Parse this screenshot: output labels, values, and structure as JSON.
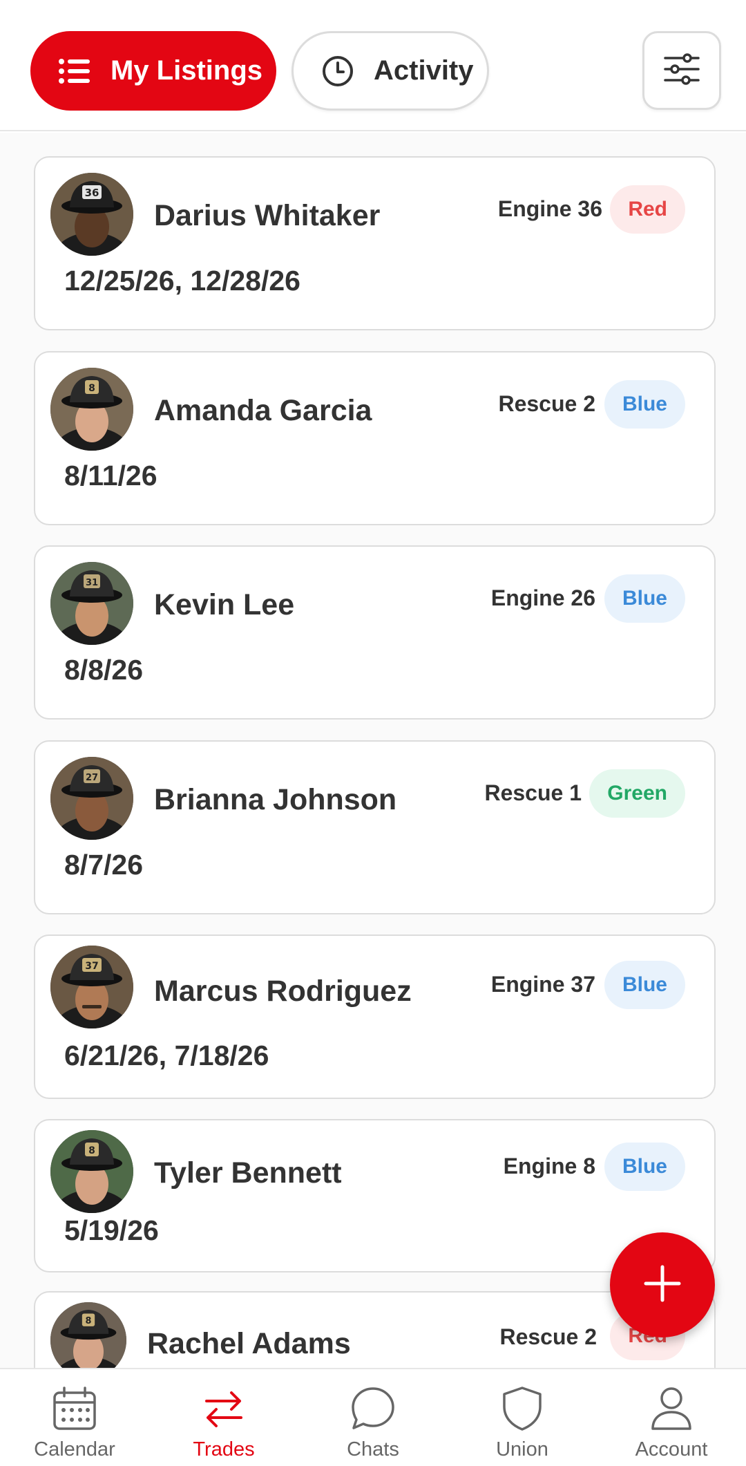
{
  "header": {
    "tabs": [
      {
        "label": "My Listings",
        "icon": "list-icon",
        "active": true
      },
      {
        "label": "Activity",
        "icon": "clock-icon",
        "active": false
      }
    ],
    "filter_icon": "sliders-icon"
  },
  "listings": [
    {
      "name": "Darius Whitaker",
      "unit": "Engine 36",
      "shift": "Red",
      "dates": "12/25/26, 12/28/26",
      "helmet": "36"
    },
    {
      "name": "Amanda Garcia",
      "unit": "Rescue 2",
      "shift": "Blue",
      "dates": "8/11/26",
      "helmet": "8"
    },
    {
      "name": "Kevin Lee",
      "unit": "Engine 26",
      "shift": "Blue",
      "dates": "8/8/26",
      "helmet": "31"
    },
    {
      "name": "Brianna Johnson",
      "unit": "Rescue 1",
      "shift": "Green",
      "dates": "8/7/26",
      "helmet": "27"
    },
    {
      "name": "Marcus Rodriguez",
      "unit": "Engine 37",
      "shift": "Blue",
      "dates": "6/21/26, 7/18/26",
      "helmet": "37"
    },
    {
      "name": "Tyler Bennett",
      "unit": "Engine 8",
      "shift": "Blue",
      "dates": "5/19/26",
      "helmet": "8"
    },
    {
      "name": "Rachel Adams",
      "unit": "Rescue 2",
      "shift": "Red",
      "dates": "",
      "helmet": "8"
    }
  ],
  "fab": {
    "icon": "plus-icon"
  },
  "bottom_nav": [
    {
      "label": "Calendar",
      "icon": "calendar-icon",
      "active": false
    },
    {
      "label": "Trades",
      "icon": "swap-arrows-icon",
      "active": true
    },
    {
      "label": "Chats",
      "icon": "chat-bubble-icon",
      "active": false
    },
    {
      "label": "Union",
      "icon": "shield-icon",
      "active": false
    },
    {
      "label": "Account",
      "icon": "person-icon",
      "active": false
    }
  ],
  "colors": {
    "accent": "#e30613",
    "red_badge": "#e64545",
    "blue_badge": "#3b8ad8",
    "green_badge": "#22a866"
  }
}
